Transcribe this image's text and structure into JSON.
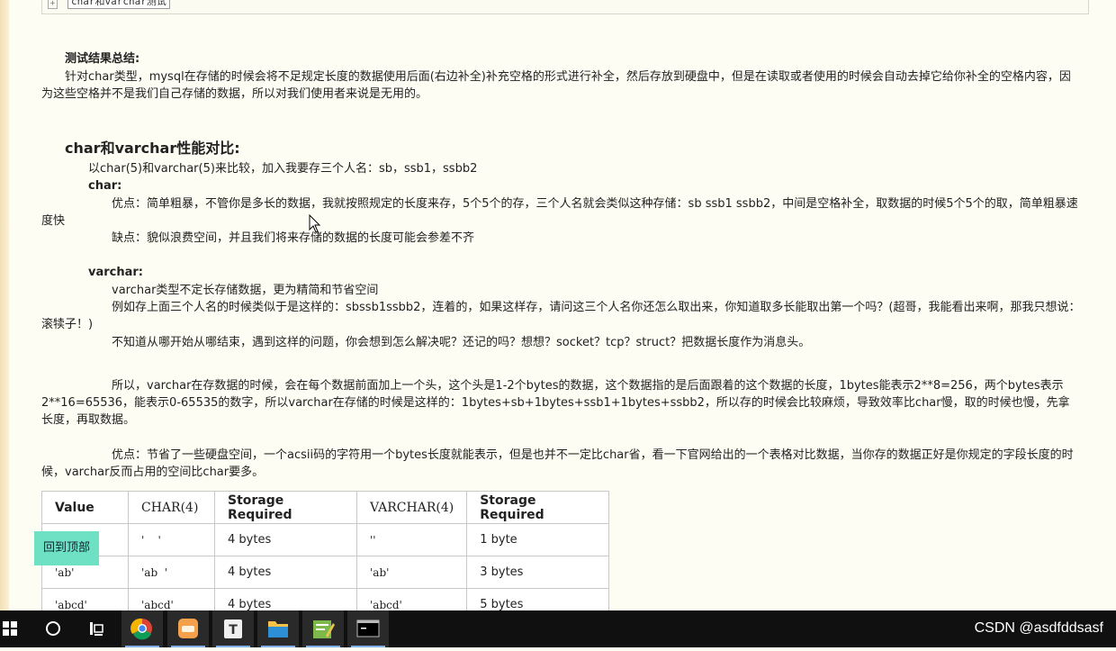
{
  "code_block": {
    "label": "char和varchar测试",
    "expand_glyph": "+"
  },
  "summary": {
    "title": "测试结果总结:",
    "para_line1": "针对char类型，mysql在存储的时候会将不足规定长度的数据使用后面(右边补全)补充空格的形式进行补全，然后存放到硬盘中，但是在读取或者使用的时候会自动去掉它给你补全的空格内容，因",
    "para_line2": "为这些空格并不是我们自己存储的数据，所以对我们使用者来说是无用的。"
  },
  "perf": {
    "heading": "char和varchar性能对比:",
    "intro": "以char(5)和varchar(5)来比较，加入我要存三个人名：sb，ssb1，ssbb2",
    "char": {
      "label": "char:",
      "pro_line1": "优点：简单粗暴，不管你是多长的数据，我就按照规定的长度来存，5个5个的存，三个人名就会类似这种存储：sb ssb1 ssbb2，中间是空格补全，取数据的时候5个5个的取，简单粗暴速",
      "pro_line2": "度快",
      "con": "缺点：貌似浪费空间，并且我们将来存储的数据的长度可能会参差不齐"
    },
    "varchar": {
      "label": "varchar:",
      "line1": "varchar类型不定长存储数据，更为精简和节省空间",
      "line2a": "例如存上面三个人名的时候类似于是这样的：sbssb1ssbb2，连着的，如果这样存，请问这三个人名你还怎么取出来，你知道取多长能取出第一个吗？(超哥，我能看出来啊，那我只想说：",
      "line2b": "滚犊子！)",
      "line3": "不知道从哪开始从哪结束，遇到这样的问题，你会想到怎么解决呢？还记的吗？想想？socket？tcp？struct？把数据长度作为消息头。"
    },
    "so_line1": "所以，varchar在存数据的时候，会在每个数据前面加上一个头，这个头是1-2个bytes的数据，这个数据指的是后面跟着的这个数据的长度，1bytes能表示2**8=256，两个bytes表示",
    "so_line2": "2**16=65536，能表示0-65535的数字，所以varchar在存储的时候是这样的：1bytes+sb+1bytes+ssb1+1bytes+ssbb2，所以存的时候会比较麻烦，导致效率比char慢，取的时候也慢，先拿",
    "so_line3": "长度，再取数据。",
    "adv_line1": "优点：节省了一些硬盘空间，一个acsii码的字符用一个bytes长度就能表示，但是也并不一定比char省，看一下官网给出的一个表格对比数据，当你存的数据正好是你规定的字段长度的时",
    "adv_line2": "候，varchar反而占用的空间比char要多。"
  },
  "table": {
    "headers": [
      "Value",
      "CHAR(4)",
      "Storage Required",
      "VARCHAR(4)",
      "Storage Required"
    ],
    "rows": [
      [
        "''",
        "'    '",
        "4 bytes",
        "''",
        "1 byte"
      ],
      [
        "'ab'",
        "'ab  '",
        "4 bytes",
        "'ab'",
        "3 bytes"
      ],
      [
        "'abcd'",
        "'abcd'",
        "4 bytes",
        "'abcd'",
        "5 bytes"
      ]
    ]
  },
  "back_to_top": "回到顶部",
  "taskbar": {
    "apps": [
      "start-icon",
      "cortana-icon",
      "task-view-icon",
      "chrome-icon",
      "app-orange-icon",
      "typora-icon",
      "file-explorer-icon",
      "notepad-icon",
      "terminal-icon"
    ],
    "tray_text": "CSDN @asdfddsasf"
  }
}
